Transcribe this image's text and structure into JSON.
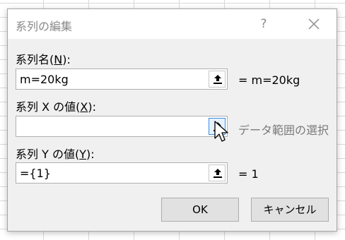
{
  "dialog": {
    "title": "系列の編集",
    "help": "?"
  },
  "series_name": {
    "label_prefix": "系列名(",
    "label_key": "N",
    "label_suffix": "):",
    "value": "m=20kg",
    "preview": "= m=20kg"
  },
  "x_values": {
    "label_prefix": "系列 X の値(",
    "label_key": "X",
    "label_suffix": "):",
    "value": "",
    "preview": "データ範囲の選択"
  },
  "y_values": {
    "label_prefix": "系列 Y の値(",
    "label_key": "Y",
    "label_suffix": "):",
    "value": "={1}",
    "preview": "= 1"
  },
  "buttons": {
    "ok": "OK",
    "cancel": "キャンセル"
  },
  "icons": {
    "collapse": "collapse-dialog-icon",
    "close": "close-icon",
    "cursor": "mouse-pointer-icon"
  }
}
